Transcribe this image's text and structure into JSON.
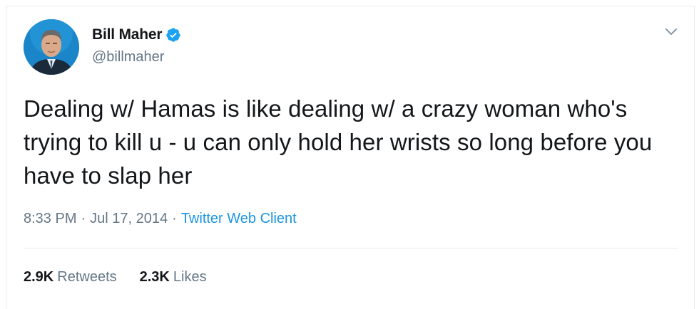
{
  "tweet": {
    "author": {
      "display_name": "Bill Maher",
      "handle": "@billmaher",
      "verified": true
    },
    "text": "Dealing w/ Hamas is like dealing w/ a crazy woman who's trying to kill u - u can only hold her wrists so long before you have to slap her",
    "time": "8:33 PM",
    "separator": "·",
    "date": "Jul 17, 2014",
    "source": "Twitter Web Client",
    "stats": {
      "retweets_count": "2.9K",
      "retweets_label": "Retweets",
      "likes_count": "2.3K",
      "likes_label": "Likes"
    }
  },
  "colors": {
    "text": "#14171a",
    "secondary": "#657786",
    "link": "#1b95e0",
    "verified": "#1da1f2",
    "border": "#e6ecf0"
  },
  "icons": {
    "verified": "verified-badge-icon",
    "menu": "chevron-down-icon"
  }
}
